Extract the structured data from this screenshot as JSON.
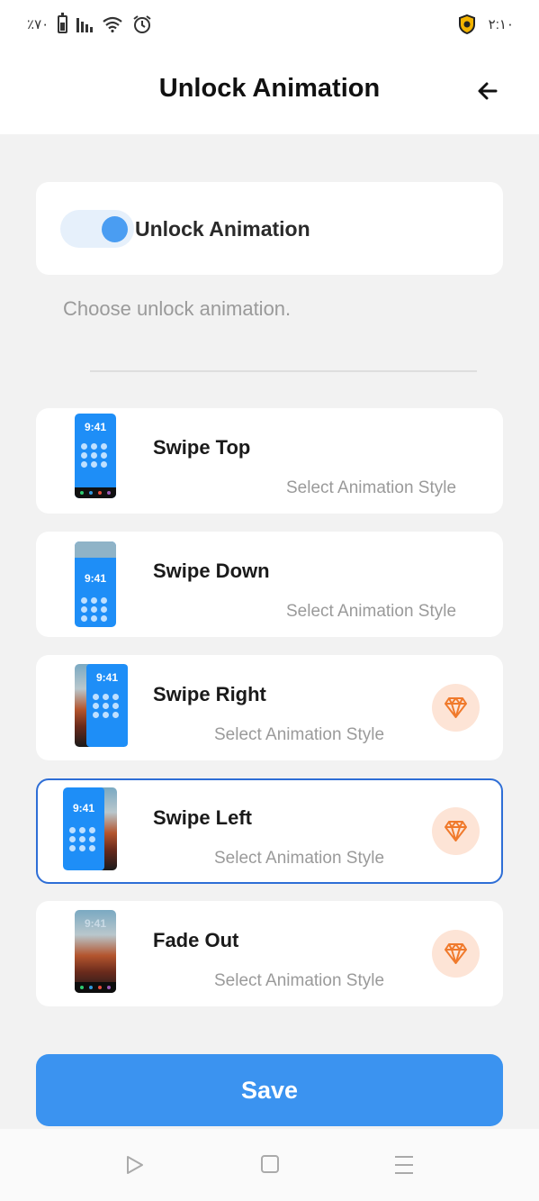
{
  "status_bar": {
    "battery_percent": "٪٧٠",
    "time": "٢:١٠",
    "icons": [
      "battery-icon",
      "signal-icon",
      "wifi-icon",
      "alarm-icon",
      "shield-icon"
    ]
  },
  "header": {
    "title": "Unlock Animation",
    "back_icon": "arrow-left-icon"
  },
  "toggle": {
    "label": "Unlock Animation",
    "enabled": true,
    "accent": "#4a9df2"
  },
  "hint": "Choose unlock animation.",
  "options": [
    {
      "name": "Swipe Top",
      "subtitle": "Select Animation Style",
      "time": "9:41",
      "premium": false,
      "selected": false
    },
    {
      "name": "Swipe Down",
      "subtitle": "Select Animation Style",
      "time": "9:41",
      "premium": false,
      "selected": false
    },
    {
      "name": "Swipe Right",
      "subtitle": "Select Animation Style",
      "time": "9:41",
      "premium": true,
      "selected": false
    },
    {
      "name": "Swipe Left",
      "subtitle": "Select Animation Style",
      "time": "9:41",
      "premium": true,
      "selected": true
    },
    {
      "name": "Fade Out",
      "subtitle": "Select Animation Style",
      "time": "9:41",
      "premium": true,
      "selected": false
    }
  ],
  "save_label": "Save",
  "colors": {
    "primary": "#3b93f0",
    "selected_border": "#2e6ed6",
    "premium_bg": "#fde4d6",
    "premium_icon": "#f07a2c"
  },
  "nav": {
    "icons": [
      "back-triangle-icon",
      "home-square-icon",
      "menu-lines-icon"
    ]
  }
}
